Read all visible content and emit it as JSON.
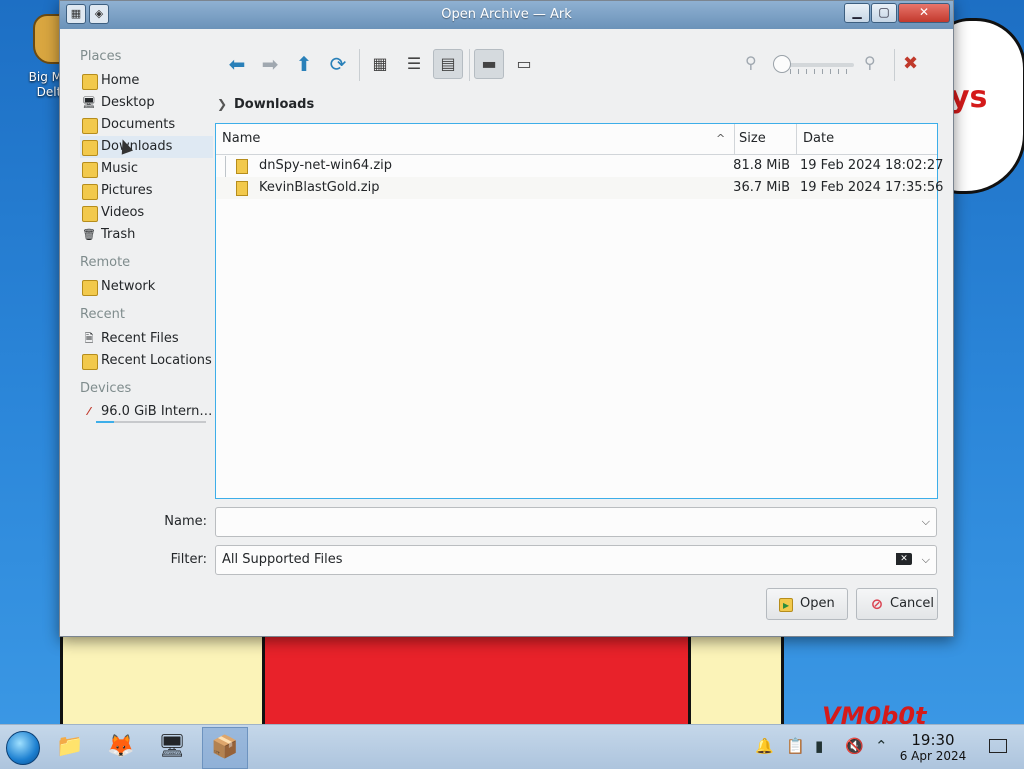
{
  "desktop": {
    "icon_label": "Big Mo… Delt…",
    "wallpaper_text_top": "ys",
    "wallpaper_text_bottom": "VM0b0t"
  },
  "window": {
    "title": "Open Archive — Ark",
    "controls": {
      "minimize": "▁",
      "maximize": "▢",
      "close": "✕"
    }
  },
  "sidebar": {
    "sections": [
      {
        "heading": "Places",
        "items": [
          {
            "label": "Home",
            "icon": "home-icon"
          },
          {
            "label": "Desktop",
            "icon": "desktop-icon"
          },
          {
            "label": "Documents",
            "icon": "documents-folder-icon"
          },
          {
            "label": "Downloads",
            "icon": "downloads-folder-icon",
            "active": true
          },
          {
            "label": "Music",
            "icon": "music-folder-icon"
          },
          {
            "label": "Pictures",
            "icon": "pictures-folder-icon"
          },
          {
            "label": "Videos",
            "icon": "videos-folder-icon"
          },
          {
            "label": "Trash",
            "icon": "trash-icon"
          }
        ]
      },
      {
        "heading": "Remote",
        "items": [
          {
            "label": "Network",
            "icon": "network-icon"
          }
        ]
      },
      {
        "heading": "Recent",
        "items": [
          {
            "label": "Recent Files",
            "icon": "recent-files-icon"
          },
          {
            "label": "Recent Locations",
            "icon": "recent-locations-icon"
          }
        ]
      },
      {
        "heading": "Devices",
        "items": [
          {
            "label": "96.0 GiB Intern…",
            "icon": "hard-disk-icon",
            "usage_fraction": 0.16
          }
        ]
      }
    ]
  },
  "toolbar": {
    "back_icon": "back-arrow-icon",
    "forward_icon": "forward-arrow-icon",
    "up_icon": "up-arrow-icon",
    "reload_icon": "reload-icon",
    "view_modes": [
      "icons-view-icon",
      "compact-view-icon",
      "detailed-view-icon"
    ],
    "active_view": "detailed-view-icon",
    "preview_icon": "preview-icon",
    "panel_icon": "panel-icon",
    "zoom_level_fraction": 0.0,
    "options_icon": "options-icon"
  },
  "breadcrumb": {
    "path": [
      "Downloads"
    ]
  },
  "file_view": {
    "columns": {
      "name": "Name",
      "size": "Size",
      "date": "Date"
    },
    "sort_column": "Name",
    "sort_glyph": "^",
    "rows": [
      {
        "name": "dnSpy-net-win64.zip",
        "size": "81.8 MiB",
        "date": "19 Feb 2024 18:02:27"
      },
      {
        "name": "KevinBlastGold.zip",
        "size": "36.7 MiB",
        "date": "19 Feb 2024 17:35:56"
      }
    ]
  },
  "form": {
    "name_label": "Name:",
    "name_value": "",
    "filter_label": "Filter:",
    "filter_value": "All Supported Files"
  },
  "buttons": {
    "open": "Open",
    "cancel": "Cancel"
  },
  "taskbar": {
    "apps": [
      "file-manager-icon",
      "firefox-icon",
      "system-monitor-icon",
      "ark-archive-icon"
    ],
    "active_app": "ark-archive-icon",
    "tray": [
      "notifications-icon",
      "clipboard-icon",
      "battery-icon",
      "volume-muted-icon",
      "expand-tray-icon"
    ],
    "time": "19:30",
    "date": "6 Apr 2024"
  },
  "colors": {
    "accent": "#3daee9",
    "titlebar": "#7ba1c6",
    "window_bg": "#eff0f1",
    "folder": "#f2c94c",
    "danger": "#da4453"
  }
}
